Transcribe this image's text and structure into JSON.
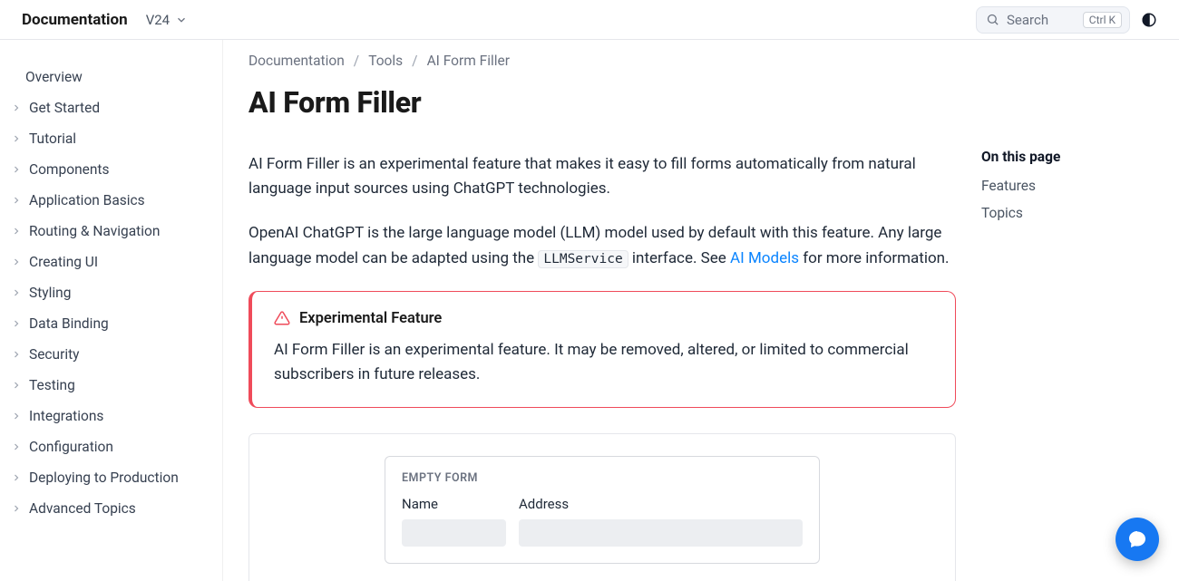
{
  "header": {
    "brand": "Documentation",
    "version": "V24",
    "search_placeholder": "Search",
    "search_kbd": "Ctrl K"
  },
  "sidebar": {
    "items": [
      {
        "label": "Overview",
        "expandable": false
      },
      {
        "label": "Get Started",
        "expandable": true
      },
      {
        "label": "Tutorial",
        "expandable": true
      },
      {
        "label": "Components",
        "expandable": true
      },
      {
        "label": "Application Basics",
        "expandable": true
      },
      {
        "label": "Routing & Navigation",
        "expandable": true
      },
      {
        "label": "Creating UI",
        "expandable": true
      },
      {
        "label": "Styling",
        "expandable": true
      },
      {
        "label": "Data Binding",
        "expandable": true
      },
      {
        "label": "Security",
        "expandable": true
      },
      {
        "label": "Testing",
        "expandable": true
      },
      {
        "label": "Integrations",
        "expandable": true
      },
      {
        "label": "Configuration",
        "expandable": true
      },
      {
        "label": "Deploying to Production",
        "expandable": true
      },
      {
        "label": "Advanced Topics",
        "expandable": true
      }
    ]
  },
  "breadcrumb": {
    "a": "Documentation",
    "b": "Tools",
    "c": "AI Form Filler"
  },
  "page": {
    "title": "AI Form Filler",
    "intro": "AI Form Filler is an experimental feature that makes it easy to fill forms automatically from natural language input sources using ChatGPT technologies.",
    "p2_a": "OpenAI ChatGPT is the large language model (LLM) model used by default with this feature. Any large language model can be adapted using the ",
    "p2_code": "LLMService",
    "p2_b": " interface. See ",
    "p2_link": "AI Models",
    "p2_c": " for more information."
  },
  "callout": {
    "title": "Experimental Feature",
    "body": "AI Form Filler is an experimental feature. It may be removed, altered, or limited to commercial subscribers in future releases."
  },
  "form": {
    "title": "EMPTY FORM",
    "name_label": "Name",
    "address_label": "Address"
  },
  "toc": {
    "title": "On this page",
    "items": [
      "Features",
      "Topics"
    ]
  }
}
